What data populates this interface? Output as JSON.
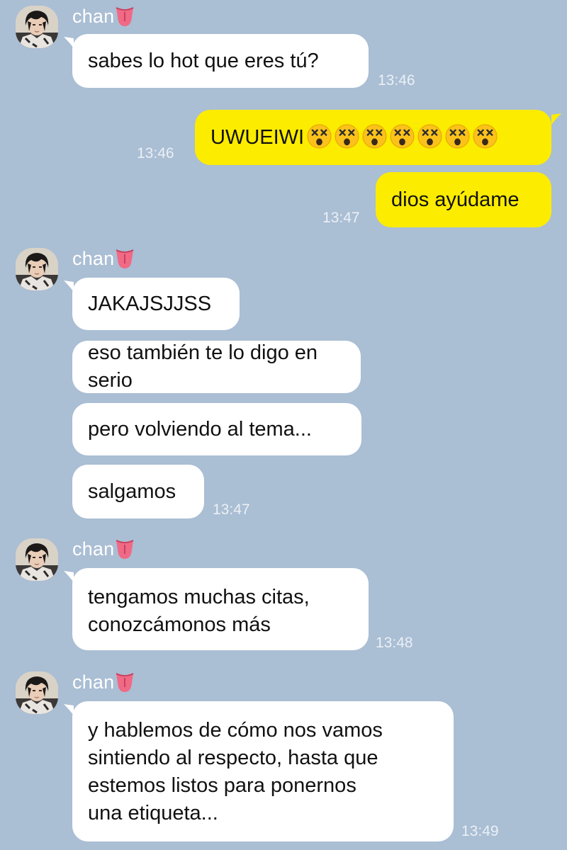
{
  "chat": {
    "groups": [
      {
        "sender": "chan",
        "messages": [
          "sabes lo hot que eres tú?"
        ],
        "time": "13:46"
      },
      {
        "outgoing": [
          {
            "text": "UWUEIWI",
            "emoji_count": 7,
            "emoji": "dizzy-face",
            "time": "13:46"
          },
          {
            "text": "dios ayúdame",
            "time": "13:47"
          }
        ]
      },
      {
        "sender": "chan",
        "messages": [
          "JAKAJSJJSS",
          "eso también te lo digo en serio",
          "pero volviendo al tema...",
          "salgamos"
        ],
        "time": "13:47"
      },
      {
        "sender": "chan",
        "messages": [
          "tengamos muchas citas,\nconozcámonos más"
        ],
        "time": "13:48"
      },
      {
        "sender": "chan",
        "messages": [
          "y hablemos de cómo nos vamos\nsintiendo al respecto, hasta que\nestemos listos para ponernos\nuna etiqueta..."
        ],
        "time": "13:49"
      }
    ],
    "sender_emoji": "tongue-emoji",
    "colors": {
      "background": "#aabed4",
      "incoming_bubble": "#ffffff",
      "outgoing_bubble": "#fcec00",
      "timestamp": "#ebf0f5"
    }
  }
}
